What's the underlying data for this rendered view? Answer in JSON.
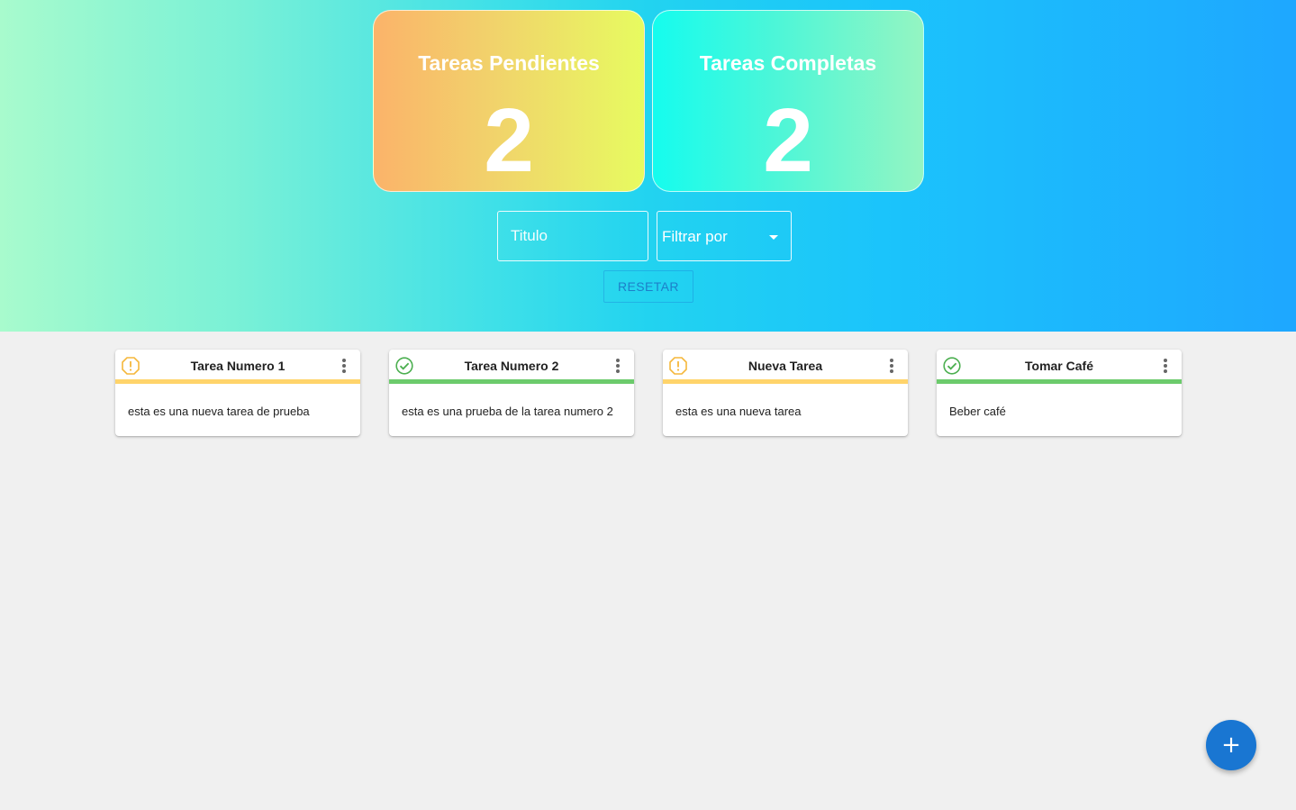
{
  "stats": {
    "pending": {
      "title": "Tareas Pendientes",
      "count": "2"
    },
    "completed": {
      "title": "Tareas Completas",
      "count": "2"
    }
  },
  "filters": {
    "title_placeholder": "Titulo",
    "title_value": "",
    "filter_label": "Filtrar por",
    "reset_label": "RESETAR"
  },
  "tasks": [
    {
      "title": "Tarea Numero 1",
      "description": "esta es una nueva tarea de prueba",
      "status": "pending",
      "icon": "alert-icon"
    },
    {
      "title": "Tarea Numero 2",
      "description": "esta es una prueba de la tarea numero 2",
      "status": "completed",
      "icon": "check-circle-icon"
    },
    {
      "title": "Nueva Tarea",
      "description": "esta es una nueva tarea",
      "status": "pending",
      "icon": "alert-icon"
    },
    {
      "title": "Tomar Café",
      "description": "Beber café",
      "status": "completed",
      "icon": "check-circle-icon"
    }
  ],
  "fab": {
    "label": "+",
    "icon": "plus-icon"
  },
  "colors": {
    "pending": "#f5b73b",
    "completed": "#4caf50",
    "primary": "#1976d2"
  }
}
